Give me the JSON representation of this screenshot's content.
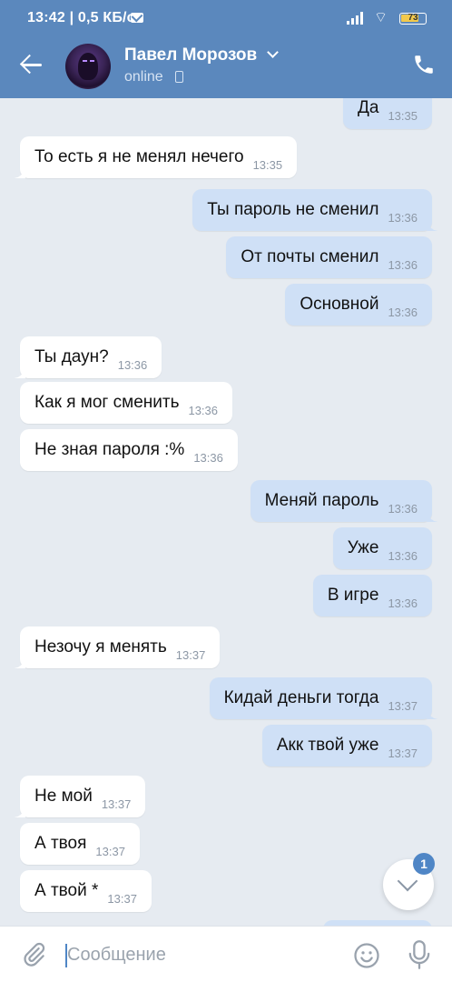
{
  "status_bar": {
    "time_speed": "13:42 | 0,5 КБ/с",
    "battery": "73",
    "battery_level": 0.73
  },
  "header": {
    "contact_name": "Павел Морозов",
    "status": "online",
    "icons": [
      "back-arrow-icon",
      "chevron-down-icon",
      "mobile-phone-icon",
      "call-icon"
    ]
  },
  "messages": [
    {
      "dir": "out",
      "text": "Да",
      "time": "13:35"
    },
    {
      "dir": "in",
      "text": "То есть я не менял нечего",
      "time": "13:35"
    },
    {
      "dir": "out",
      "text": "Ты пароль не сменил",
      "time": "13:36"
    },
    {
      "dir": "out",
      "text": "От почты сменил",
      "time": "13:36"
    },
    {
      "dir": "out",
      "text": "Основной",
      "time": "13:36"
    },
    {
      "dir": "in",
      "text": "Ты даун?",
      "time": "13:36"
    },
    {
      "dir": "in",
      "text": "Как я мог сменить",
      "time": "13:36"
    },
    {
      "dir": "in",
      "text": "Не зная пароля :%",
      "time": "13:36"
    },
    {
      "dir": "out",
      "text": "Меняй пароль",
      "time": "13:36"
    },
    {
      "dir": "out",
      "text": "Уже",
      "time": "13:36"
    },
    {
      "dir": "out",
      "text": "В игре",
      "time": "13:36"
    },
    {
      "dir": "in",
      "text": "Незочу я менять",
      "time": "13:37"
    },
    {
      "dir": "out",
      "text": "Кидай деньги тогда",
      "time": "13:37"
    },
    {
      "dir": "out",
      "text": "Акк твой уже",
      "time": "13:37"
    },
    {
      "dir": "in",
      "text": "Не мой",
      "time": "13:37"
    },
    {
      "dir": "in",
      "text": "А твоя",
      "time": "13:37"
    },
    {
      "dir": "in",
      "text": "А твой *",
      "time": "13:37"
    }
  ],
  "scroll_badge": "1",
  "composer": {
    "placeholder": "Сообщение",
    "icons": [
      "attach-icon",
      "emoji-icon",
      "microphone-icon"
    ]
  },
  "colors": {
    "header": "#5b88bd",
    "background": "#e6ebf1",
    "incoming": "#ffffff",
    "outgoing": "#cfe0f6",
    "accent": "#4f86c6"
  }
}
